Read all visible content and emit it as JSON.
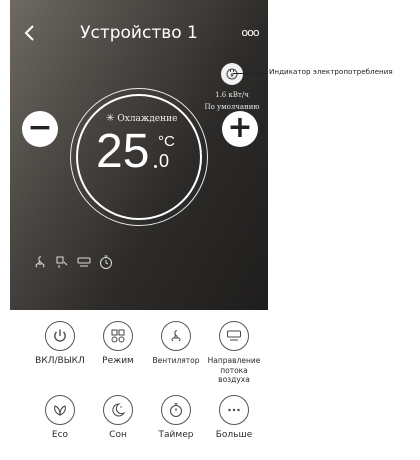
{
  "header": {
    "back_icon": "chevron-left-icon",
    "title": "Устройство 1",
    "more_label": "ooo"
  },
  "power": {
    "value": "1.6 кВт/ч",
    "mode": "По умолчанию",
    "annotation": "Индикатор электропотребления"
  },
  "thermostat": {
    "mode_label": "Охлаждение",
    "temp_integer": "25",
    "temp_unit": "°C",
    "temp_decimal": "0",
    "minus_label": "−",
    "plus_label": "+"
  },
  "status_icons": [
    "fan-icon",
    "swing-icon",
    "airflow-icon",
    "timer-icon"
  ],
  "controls": {
    "power": "ВКЛ/ВЫКЛ",
    "mode": "Режим",
    "fan": "Вентилятор",
    "airflow_line1": "Направление",
    "airflow_line2": "потока воздуха",
    "eco": "Eco",
    "sleep": "Сон",
    "timer": "Таймер",
    "more": "Больше"
  },
  "colors": {
    "screen_gradient_start": "#6e6963",
    "screen_gradient_end": "#1f1e1d",
    "control_stroke": "#555555"
  }
}
